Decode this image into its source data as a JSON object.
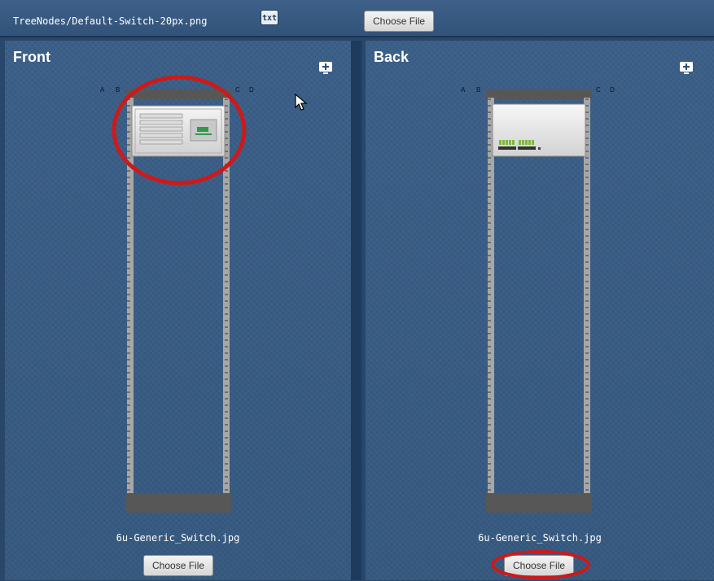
{
  "top": {
    "path": "TreeNodes/Default-Switch-20px.png",
    "txt_icon_label": "txt",
    "choose_file_label": "Choose File"
  },
  "front": {
    "title": "Front",
    "letters": [
      "A",
      "B",
      "C",
      "D"
    ],
    "filename": "6u-Generic_Switch.jpg",
    "choose_file_label": "Choose File",
    "highlight_color": "#cc1a1a"
  },
  "back": {
    "title": "Back",
    "letters": [
      "A",
      "B",
      "C",
      "D"
    ],
    "filename": "6u-Generic_Switch.jpg",
    "choose_file_label": "Choose File",
    "highlight_color": "#cc1a1a"
  },
  "icons": {
    "add_device": "monitor-plus-icon",
    "txt": "txt-file-icon",
    "cursor": "mouse-pointer-icon"
  }
}
